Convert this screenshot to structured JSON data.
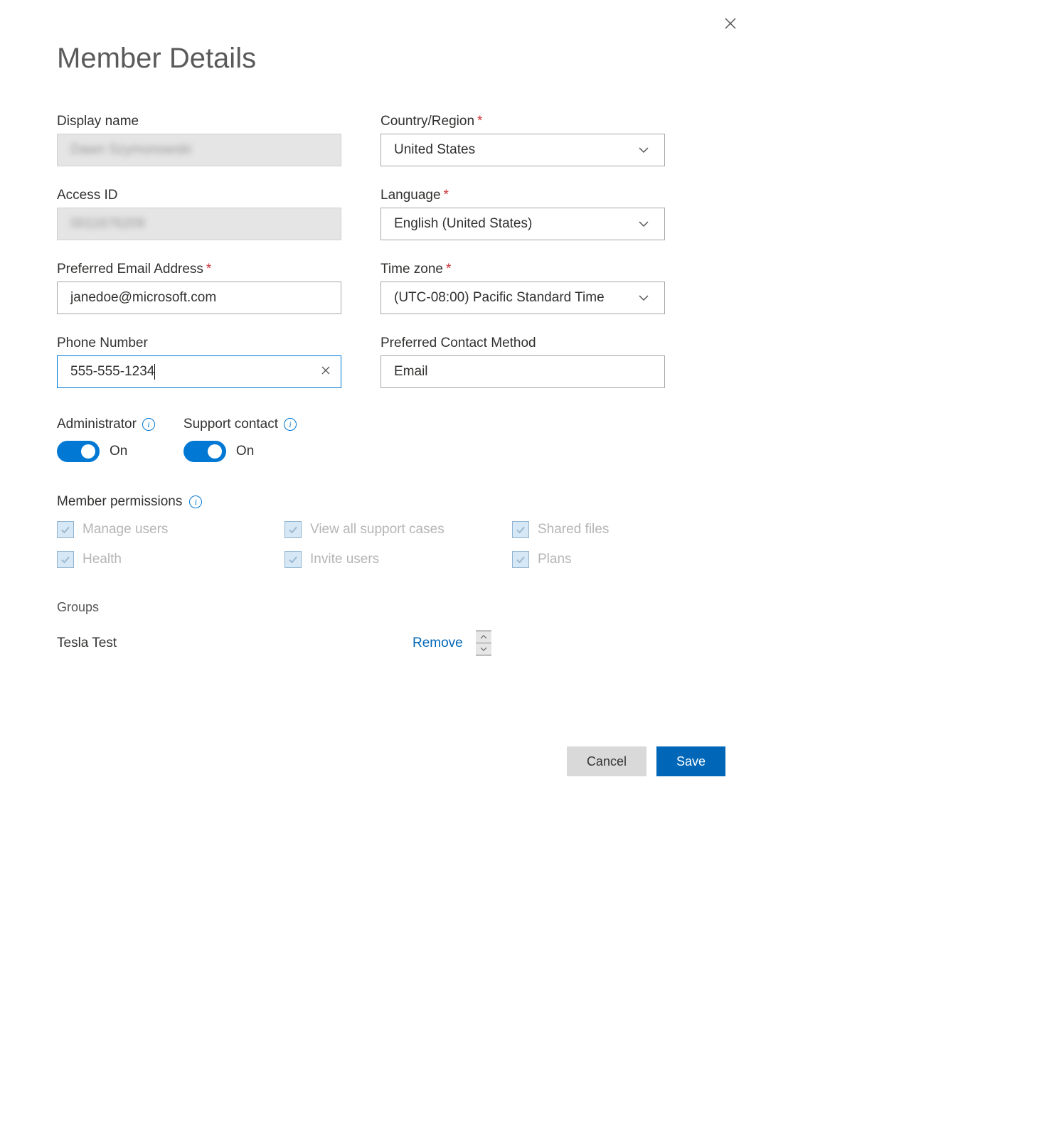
{
  "header": {
    "title": "Member Details"
  },
  "fields": {
    "display_name": {
      "label": "Display name",
      "value": "Dawn Szymonowski"
    },
    "access_id": {
      "label": "Access ID",
      "value": "0011676209"
    },
    "email": {
      "label": "Preferred Email Address",
      "value": "janedoe@microsoft.com"
    },
    "phone": {
      "label": "Phone Number",
      "value": "555-555-1234"
    },
    "country": {
      "label": "Country/Region",
      "value": "United States"
    },
    "language": {
      "label": "Language",
      "value": "English (United States)"
    },
    "timezone": {
      "label": "Time zone",
      "value": "(UTC-08:00) Pacific Standard Time"
    },
    "contact_method": {
      "label": "Preferred Contact Method",
      "value": "Email"
    }
  },
  "roles": {
    "administrator": {
      "label": "Administrator",
      "state": "On"
    },
    "support_contact": {
      "label": "Support contact",
      "state": "On"
    }
  },
  "permissions": {
    "title": "Member permissions",
    "items": [
      "Manage users",
      "View all support cases",
      "Shared files",
      "Health",
      "Invite users",
      "Plans"
    ]
  },
  "groups": {
    "title": "Groups",
    "items": [
      {
        "name": "Tesla Test",
        "remove": "Remove"
      }
    ]
  },
  "footer": {
    "cancel": "Cancel",
    "save": "Save"
  }
}
